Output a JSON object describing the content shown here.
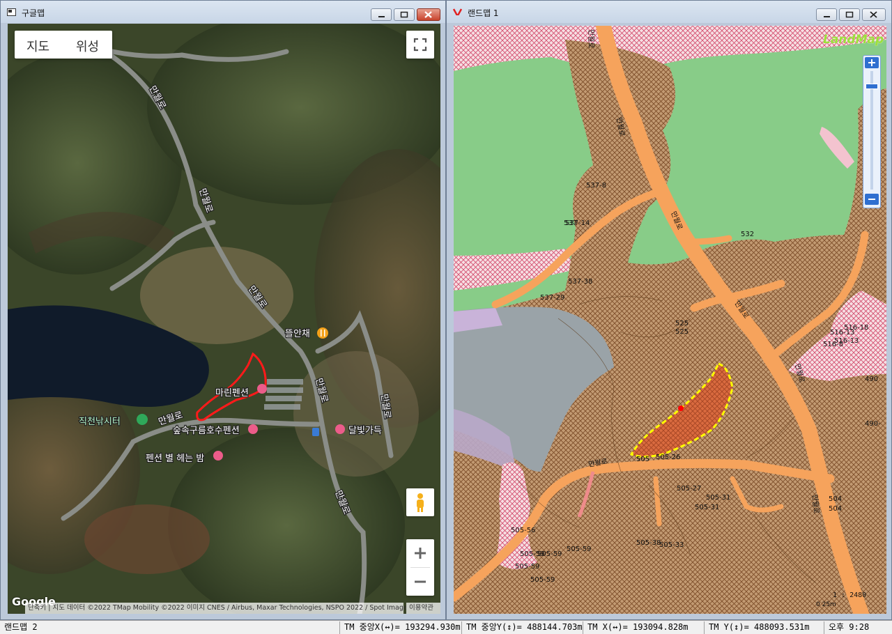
{
  "left_window": {
    "title": "구글맵",
    "map_type": {
      "map_label": "지도",
      "satellite_label": "위성"
    },
    "roads": {
      "r1": "만월로",
      "r2": "만월로",
      "r3": "만월로",
      "r4": "만월로",
      "r5": "만월로",
      "r6": "만월로",
      "r7": "만월로"
    },
    "places": {
      "p1": "뜰안채",
      "p2": "마린펜션",
      "p3": "직천낚시터",
      "p4": "숲속구름호수펜션",
      "p5": "달빛가득",
      "p6": "펜션 별 헤는 밤"
    },
    "logo": "Google",
    "attribution": "단축키 | 지도 데이터 ©2022 TMap Mobility ©2022 이미지 CNES / Airbus, Maxar Technologies, NSPO 2022 / Spot Image",
    "terms": "이용약관",
    "colors": {
      "outline": "#ff1a1a"
    }
  },
  "right_window": {
    "title": "랜드맵 1",
    "logo": "LandMap",
    "parcels": {
      "l1": "537-8",
      "l2": "537-14",
      "l3": "537",
      "l4": "537-38",
      "l5": "537-29",
      "l6": "532",
      "l7": "525",
      "l8": "525",
      "l9": "516-18",
      "l10": "516-13",
      "l11": "516-13",
      "l12": "516-8",
      "l13": "490",
      "l14": "490-",
      "l15": "505-26",
      "l16": "505",
      "l17": "505-27",
      "l18": "505-31",
      "l19": "505-31",
      "l20": "504",
      "l21": "504",
      "l22": "505-33",
      "l23": "505-38",
      "l24": "505-59",
      "l25": "505-59",
      "l26": "505-59",
      "l27": "505-59",
      "l28": "505-59",
      "l29": "505-56"
    },
    "roads": {
      "r1": "만월로",
      "r2": "만월로",
      "r3": "만월로",
      "r4": "만월로",
      "r5": "만월로",
      "r6": "만월로",
      "r7": "만월로"
    },
    "scale": "1 : 2480",
    "scale_bar": "0 25m",
    "colors": {
      "green": "#88cc88",
      "brown": "#c8986a",
      "road": "#f6a35c",
      "gray": "#9aa3a8",
      "selection": "#ffff00"
    }
  },
  "status_bar": {
    "app": "랜드맵 2",
    "tm_cx": "TM 중앙X(↔)= 193294.930m",
    "tm_cy": "TM 중앙Y(↕)= 488144.703m",
    "tm_x": "TM X(↔)= 193094.828m",
    "tm_y": "TM Y(↕)= 488093.531m",
    "time": "오후 9:28"
  }
}
